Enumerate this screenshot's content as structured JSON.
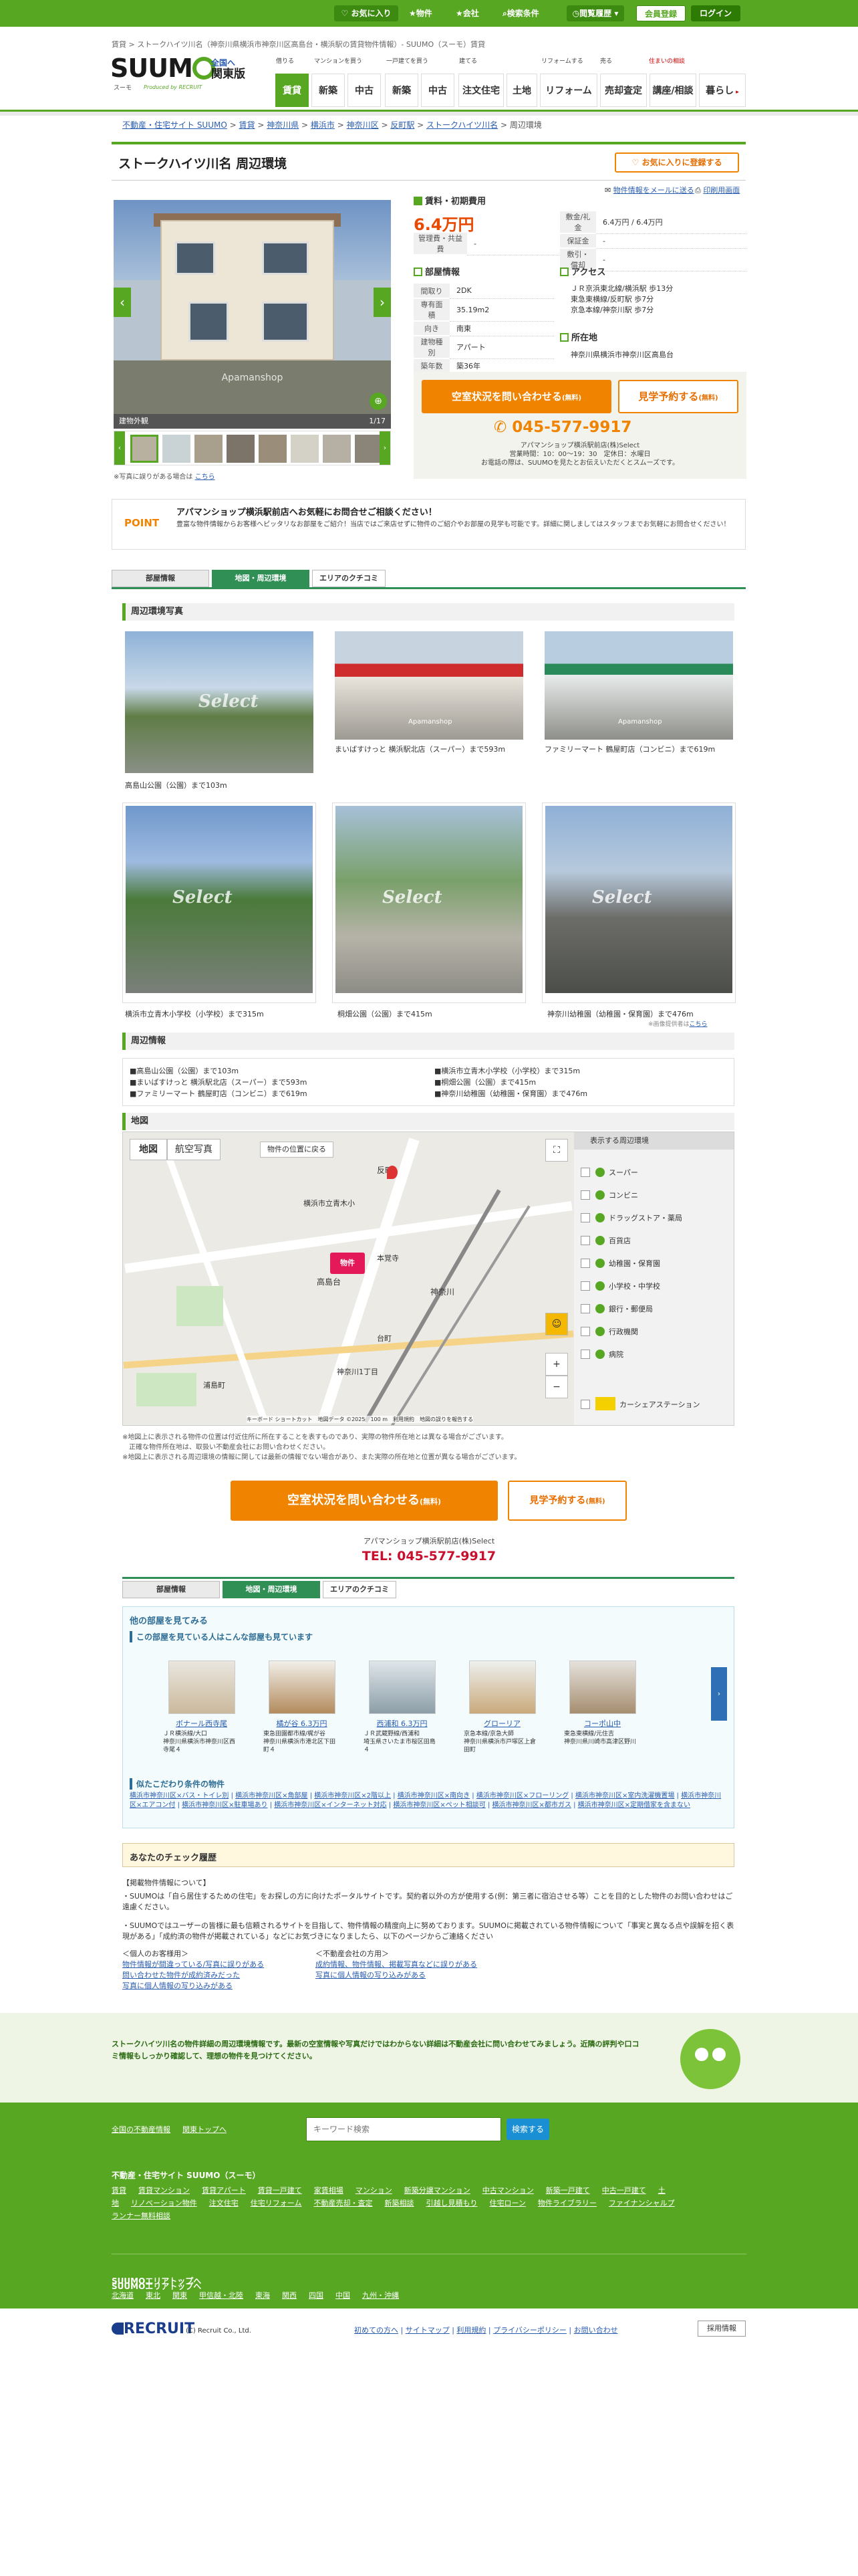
{
  "topbar": {
    "favorites": "お気に入り",
    "properties": "物件",
    "companies": "会社",
    "search_history": "検索条件",
    "browsing_history": "閲覧履歴",
    "register": "会員登録",
    "login": "ログイン"
  },
  "top_breadcrumb": "賃貸 > ストークハイツ川名（神奈川県横浜市神奈川区高島台・横浜駅の賃貸物件情報）- SUUMO（スーモ）賃貸",
  "header": {
    "logo": "SUUM",
    "logo_o": "",
    "logo_kana": "スーモ",
    "logo_tagline": "Produced by RECRUIT",
    "area_line1": "全国へ",
    "area_line2": "関東版",
    "nav_groups": [
      "借りる",
      "マンションを買う",
      "一戸建てを買う",
      "建てる",
      "リフォームする",
      "売る",
      "住まいの相談"
    ],
    "nav": [
      "賃貸",
      "新築",
      "中古",
      "新築",
      "中古",
      "注文住宅",
      "土地",
      "リフォーム",
      "売却査定",
      "講座/相談",
      "暮らし"
    ]
  },
  "breadcrumb": [
    "不動産・住宅サイト SUUMO",
    "賃貸",
    "神奈川県",
    "横浜市",
    "神奈川区",
    "反町駅",
    "ストークハイツ川名",
    "周辺環境"
  ],
  "property": {
    "title": "ストークハイツ川名 周辺環境",
    "favorite_button": "お気に入りに登録する",
    "send_email": "物件情報をメールに送る",
    "print": "印刷用画面",
    "photo_caption": "建物外観",
    "photo_count": "1/17",
    "photo_watermark": "Apamanshop",
    "photo_report": "※写真に誤りがある場合は",
    "photo_report_link": "こちら"
  },
  "rent": {
    "heading": "賃料・初期費用",
    "price": "6.4万円",
    "mgmt_label": "管理費・共益費",
    "mgmt_value": "-",
    "deposit_label": "敷金/礼金",
    "deposit_value": "6.4万円 / 6.4万円",
    "guarantee_label": "保証金",
    "guarantee_value": "-",
    "shiki_label": "敷引・償却",
    "shiki_value": "-"
  },
  "room": {
    "heading": "部屋情報",
    "rows": [
      {
        "label": "間取り",
        "value": "2DK"
      },
      {
        "label": "専有面積",
        "value": "35.19m2"
      },
      {
        "label": "向き",
        "value": "南東"
      },
      {
        "label": "建物種別",
        "value": "アパート"
      },
      {
        "label": "築年数",
        "value": "築36年"
      }
    ]
  },
  "access": {
    "heading": "アクセス",
    "lines": [
      "ＪＲ京浜東北線/横浜駅 歩13分",
      "東急東横線/反町駅 歩7分",
      "京急本線/神奈川駅 歩7分"
    ],
    "address_heading": "所在地",
    "address": "神奈川県横浜市神奈川区高島台"
  },
  "cta": {
    "inquire": "空室状況を問い合わせる",
    "free": "(無料)",
    "reserve": "見学予約する",
    "phone": "045-577-9917",
    "shop": "アパマンショップ横浜駅前店(株)Select",
    "hours": "営業時間：10：00〜19：30　定休日：水曜日",
    "note": "お電話の際は、SUUMOを見たとお伝えいただくとスムーズです。"
  },
  "point": {
    "label": "POINT",
    "headline": "アパマンショップ横浜駅前店へお気軽にお問合せご相談ください！",
    "body": "豊富な物件情報からお客様へピッタリなお部屋をご紹介！当店ではご来店せずに物件のご紹介やお部屋の見学も可能です。詳細に関しましてはスタッフまでお気軽にお問合せください！"
  },
  "tabs": [
    "部屋情報",
    "地図・周辺環境",
    "エリアのクチコミ"
  ],
  "surroundings": {
    "heading": "周辺環境写真",
    "photos": [
      {
        "caption": "高島山公園（公園）まで103m"
      },
      {
        "caption": "まいばすけっと 横浜駅北店（スーパー）まで593m"
      },
      {
        "caption": "ファミリーマート 鶴屋町店（コンビニ）まで619m"
      },
      {
        "caption": "横浜市立青木小学校（小学校）まで315m"
      },
      {
        "caption": "桐畑公園（公園）まで415m"
      },
      {
        "caption": "神奈川幼稚園（幼稚園・保育園）まで476m"
      }
    ],
    "select_watermark": "Select",
    "photo_note": "※画像提供者は",
    "photo_note_link": "こちら"
  },
  "nearby": {
    "heading": "周辺情報",
    "left": [
      "高島山公園（公園）まで103m",
      "まいばすけっと 横浜駅北店（スーパー）まで593m",
      "ファミリーマート 鶴屋町店（コンビニ）まで619m"
    ],
    "right": [
      "横浜市立青木小学校（小学校）まで315m",
      "桐畑公園（公園）まで415m",
      "神奈川幼稚園（幼稚園・保育園）まで476m"
    ]
  },
  "map": {
    "heading": "地図",
    "map_tab": "地図",
    "satellite_tab": "航空写真",
    "back_to_property": "物件の位置に戻る",
    "pin_label": "物件",
    "place_labels": [
      "反町",
      "横浜市立青木小",
      "本覚寺",
      "高島台",
      "神奈川",
      "台町",
      "浦島町",
      "神奈川1丁目"
    ],
    "footer": "キーボード ショートカット　地図データ ©2025　100 m　利用規約　地図の誤りを報告する",
    "legend_title": "表示する周辺環境",
    "legend": [
      "スーパー",
      "コンビニ",
      "ドラッグストア・薬局",
      "百貨店",
      "幼稚園・保育園",
      "小学校・中学校",
      "銀行・郵便局",
      "行政機関",
      "病院"
    ],
    "carshare": "カーシェアステーション",
    "notes": [
      "※地図上に表示される物件の位置は付近住所に所在することを表すものであり、実際の物件所在地とは異なる場合がございます。",
      "　正確な物件所在地は、取扱い不動産会社にお問い合わせください。",
      "※地図上に表示される周辺環境の情報に関しては最新の情報でない場合があり、また実際の所在地と位置が異なる場合がございます。"
    ]
  },
  "bottom_cta": {
    "inquire": "空室状況を問い合わせる",
    "free": "(無料)",
    "reserve": "見学予約する",
    "shop": "アパマンショップ横浜駅前店(株)Select",
    "tel": "TEL: 045-577-9917"
  },
  "other_rooms": {
    "heading": "他の部屋を見てみる",
    "subheading": "この部屋を見ている人はこんな部屋も見ています",
    "rooms": [
      {
        "name": "ボナール西寺尾",
        "price": "",
        "desc": "ＪＲ横浜線/大口\n神奈川県横浜市神奈川区西寺尾４"
      },
      {
        "name": "橘が谷 6.3万円",
        "price": "",
        "desc": "東急田園都市線/梶が谷\n神奈川県横浜市港北区下田町４"
      },
      {
        "name": "西浦和 6.3万円",
        "price": "",
        "desc": "ＪＲ武蔵野線/西浦和\n埼玉県さいたま市桜区田島４"
      },
      {
        "name": "グローリア",
        "price": "",
        "desc": "京急本線/京急大師\n神奈川県横浜市戸塚区上倉田町"
      },
      {
        "name": "コーポ山中",
        "price": "",
        "desc": "東急東横線/元住吉\n神奈川県川崎市高津区野川"
      }
    ],
    "conditions_heading": "似たこだわり条件の物件",
    "conditions": [
      "横浜市神奈川区×バス・トイレ別",
      "横浜市神奈川区×角部屋",
      "横浜市神奈川区×2階以上",
      "横浜市神奈川区×南向き",
      "横浜市神奈川区×フローリング",
      "横浜市神奈川区×室内洗濯機置場",
      "横浜市神奈川区×エアコン付",
      "横浜市神奈川区×駐車場あり",
      "横浜市神奈川区×インターネット対応",
      "横浜市神奈川区×ペット相談可",
      "横浜市神奈川区×都市ガス",
      "横浜市神奈川区×定期借家を含まない"
    ]
  },
  "history": {
    "heading": "あなたのチェック履歴"
  },
  "disclaimer": {
    "h": "【掲載物件情報について】",
    "p1": "・SUUMOは「自ら居住するための住宅」をお探しの方に向けたポータルサイトです。契約者以外の方が使用する(例：第三者に宿泊させる等）ことを目的とした物件のお問い合わせはご遠慮ください。",
    "p2": "・SUUMOではユーザーの皆様に最も信頼されるサイトを目指して、物件情報の精度向上に努めております。SUUMOに掲載されている物件情報について「事実と異なる点や誤解を招く表現がある」「成約済の物件が掲載されている」などにお気づきになりましたら、以下のページからご連絡ください",
    "left_h": "＜個人のお客様用＞",
    "left": [
      "物件情報が間違っている/写真に誤りがある",
      "問い合わせた物件が成約済みだった",
      "写真に個人情報の写り込みがある"
    ],
    "right_h": "＜不動産会社の方用＞",
    "right": [
      "成約情報、物件情報、掲載写真などに誤りがある",
      "写真に個人情報の写り込みがある"
    ]
  },
  "footer_note": "ストークハイツ川名の物件詳細の周辺環境情報です。最新の空室情報や写真だけではわからない詳細は不動産会社に問い合わせてみましょう。近隣の評判や口コミ情報もしっかり確認して、理想の物件を見つけてください。",
  "footer": {
    "links_top": [
      "全国の不動産情報",
      "関東トップへ"
    ],
    "search_placeholder": "キーワード検索",
    "search_button": "検索する",
    "site_heading": "不動産・住宅サイト SUUMO（スーモ）",
    "site_links": [
      "賃貸",
      "賃貸マンション",
      "賃貸アパート",
      "賃貸一戸建て",
      "家賃相場",
      "マンション",
      "新築分譲マンション",
      "中古マンション",
      "新築一戸建て",
      "中古一戸建て",
      "土地",
      "リノベーション物件",
      "注文住宅",
      "住宅リフォーム",
      "不動産売却・査定",
      "新築相談",
      "引越し見積もり",
      "住宅ローン",
      "物件ライブラリー",
      "ファイナンシャルプランナー無料相談"
    ],
    "area_heading": "SUUMOエリアトップへ",
    "areas": [
      "北海道",
      "東北",
      "関東",
      "甲信越・北陸",
      "東海",
      "関西",
      "四国",
      "中国",
      "九州・沖縄"
    ],
    "recruit": "RECRUIT",
    "copyright": "(C) Recruit Co., Ltd.",
    "bottom_links": [
      "初めての方へ",
      "サイトマップ",
      "利用規約",
      "プライバシーポリシー",
      "お問い合わせ"
    ],
    "jobs": "採用情報"
  },
  "colors": {
    "brand": "#57a722",
    "accent": "#f08300",
    "price": "#e74a00"
  }
}
